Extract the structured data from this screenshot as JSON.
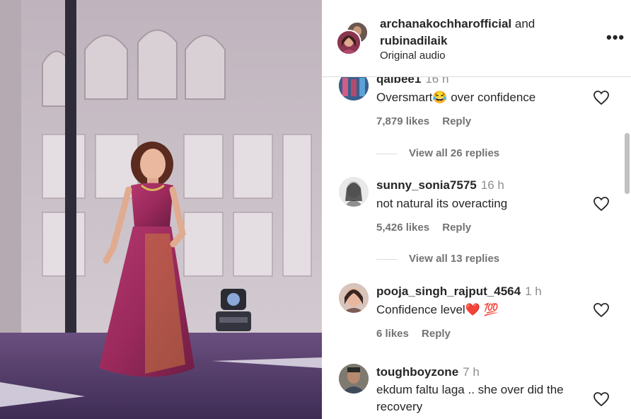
{
  "header": {
    "user1": "archanakochharofficial",
    "and": "and",
    "user2": "rubinadilaik",
    "subtitle": "Original audio",
    "more": "•••"
  },
  "comments": [
    {
      "user": "qalbee1",
      "time": "16 h",
      "text": "Oversmart😂 over confidence",
      "likes": "7,879 likes",
      "reply": "Reply",
      "view_replies": "View all 26 replies"
    },
    {
      "user": "sunny_sonia7575",
      "time": "16 h",
      "text": "not natural its overacting",
      "likes": "5,426 likes",
      "reply": "Reply",
      "view_replies": "View all 13 replies"
    },
    {
      "user": "pooja_singh_rajput_4564",
      "time": "1 h",
      "text": "Confidence level❤️ 💯",
      "likes": "6 likes",
      "reply": "Reply"
    },
    {
      "user": "toughboyzone",
      "time": "7 h",
      "text": "ekdum faltu laga .. she over did the recovery"
    }
  ]
}
